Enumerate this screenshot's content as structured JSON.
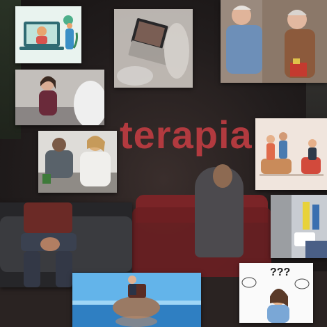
{
  "title": {
    "text": "terapia",
    "color": "#b23a3f"
  },
  "tiles": [
    {
      "name": "online-therapy-illustration"
    },
    {
      "name": "laptop-session-photo"
    },
    {
      "name": "elderly-couple-photo"
    },
    {
      "name": "worried-woman-photo"
    },
    {
      "name": "couple-therapy-illustration"
    },
    {
      "name": "counselor-consoling-man-photo"
    },
    {
      "name": "man-on-couch-photo"
    },
    {
      "name": "woman-in-session-photo"
    },
    {
      "name": "head-in-water-photo"
    },
    {
      "name": "confused-woman-question-marks"
    }
  ],
  "question_marks": "???",
  "colors": {
    "accent": "#b23a3f",
    "background": "#1e1b1b",
    "couch": "#6b1f22"
  }
}
